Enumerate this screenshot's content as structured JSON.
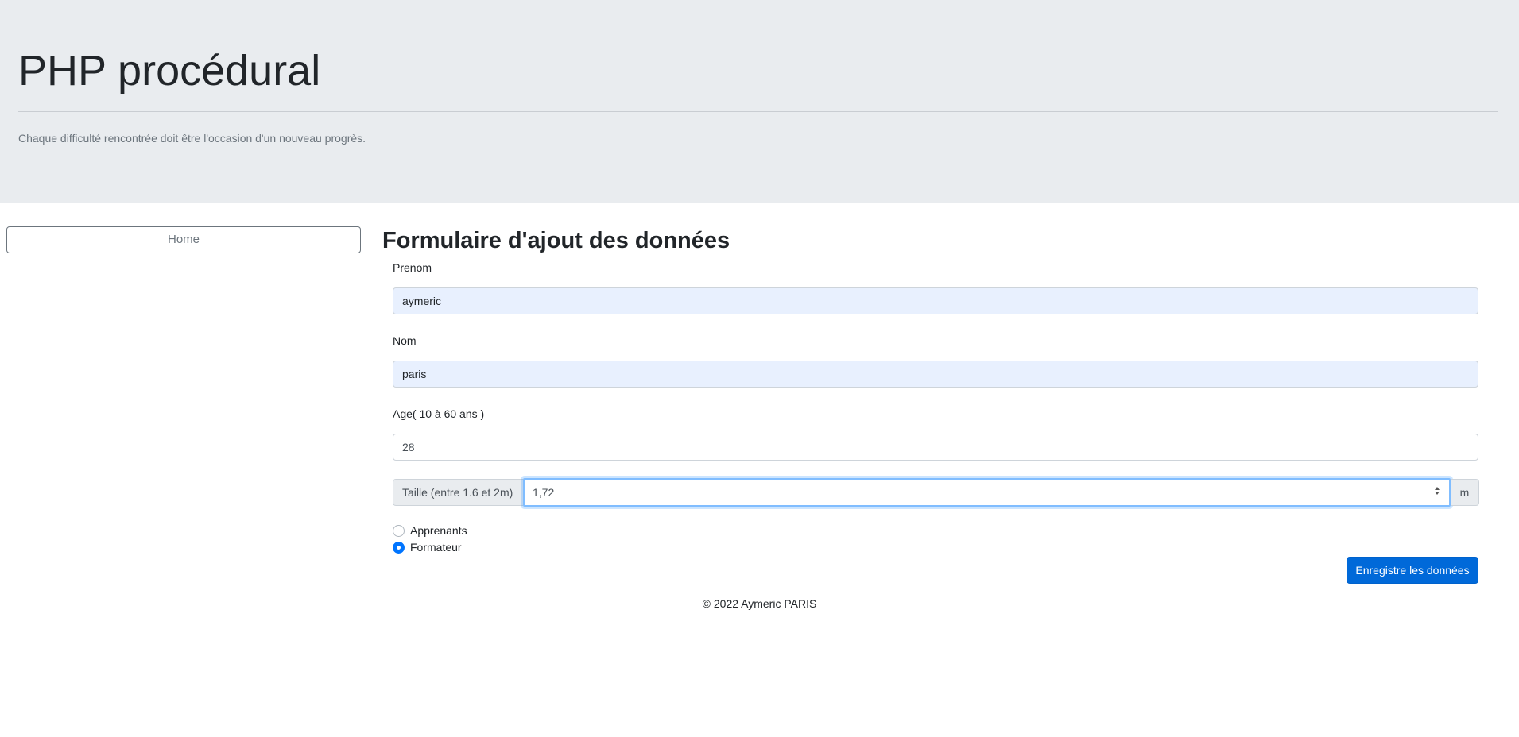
{
  "header": {
    "title": "PHP procédural",
    "lead": "Chaque difficulté rencontrée doit être l'occasion d'un nouveau progrès."
  },
  "sidebar": {
    "home_label": "Home"
  },
  "form": {
    "title": "Formulaire d'ajout des données",
    "prenom": {
      "label": "Prenom",
      "value": "aymeric"
    },
    "nom": {
      "label": "Nom",
      "value": "paris"
    },
    "age": {
      "label": "Age( 10 à 60 ans )",
      "value": "28"
    },
    "taille": {
      "prefix": "Taille (entre 1.6 et 2m)",
      "value": "1,72",
      "suffix": "m"
    },
    "roles": [
      {
        "label": "Apprenants",
        "checked": false
      },
      {
        "label": "Formateur",
        "checked": true
      }
    ],
    "submit_label": "Enregistre les données"
  },
  "footer": {
    "text": "© 2022 Aymeric PARIS"
  },
  "colors": {
    "jumbotron_bg": "#e9ecef",
    "primary": "#0069d9",
    "autofill_bg": "#e8f0fe"
  }
}
